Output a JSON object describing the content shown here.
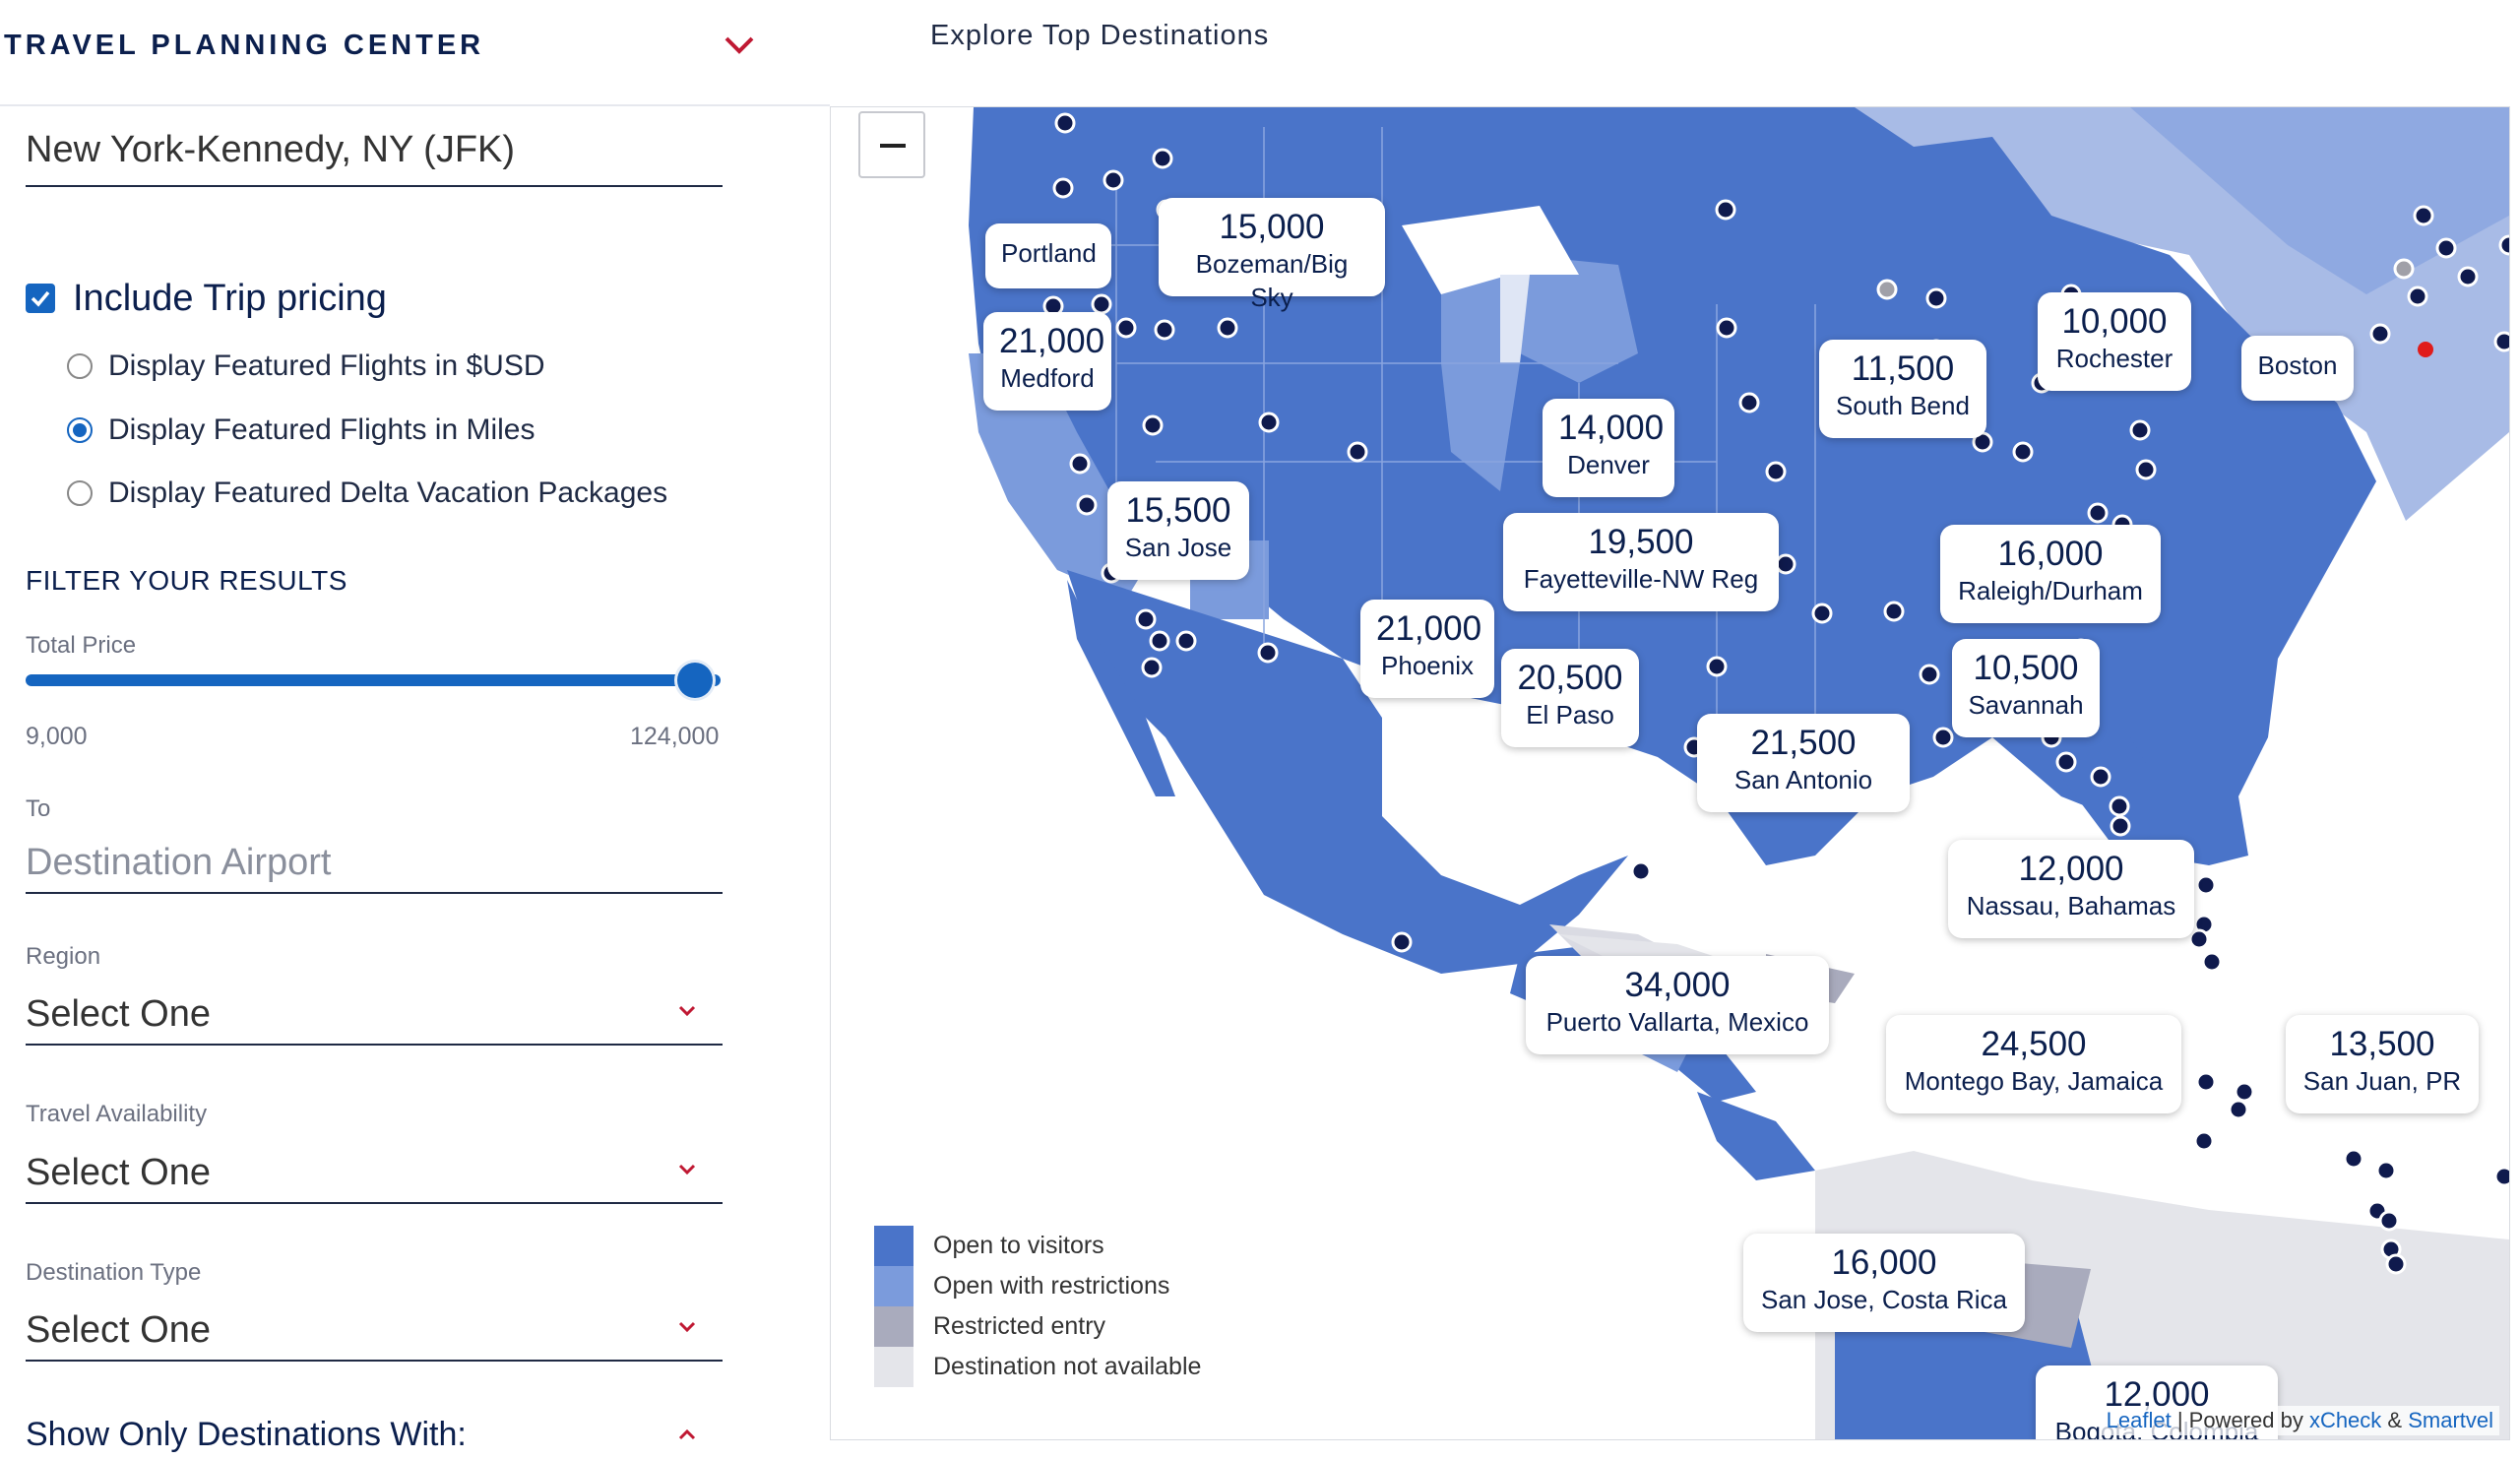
{
  "sidebar": {
    "title": "TRAVEL PLANNING CENTER",
    "origin": "New York-Kennedy, NY (JFK)",
    "include_trip_pricing": "Include Trip pricing",
    "radios": [
      {
        "label": "Display Featured Flights in $USD",
        "selected": false
      },
      {
        "label": "Display Featured Flights in Miles",
        "selected": true
      },
      {
        "label": "Display Featured Delta Vacation Packages",
        "selected": false
      }
    ],
    "filter_heading": "FILTER YOUR RESULTS",
    "total_price_label": "Total Price",
    "price_min": "9,000",
    "price_max": "124,000",
    "price_slider_fraction": 1.0,
    "to_label": "To",
    "to_placeholder": "Destination Airport",
    "region_label": "Region",
    "region_value": "Select One",
    "availability_label": "Travel Availability",
    "availability_value": "Select One",
    "dest_type_label": "Destination Type",
    "dest_type_value": "Select One",
    "show_only": "Show Only Destinations With:"
  },
  "map": {
    "title": "Explore Top Destinations",
    "zoom_out": "−",
    "callouts": [
      {
        "miles": "",
        "city": "Portland"
      },
      {
        "miles": "15,000",
        "city": "Bozeman/Big Sky"
      },
      {
        "miles": "21,000",
        "city": "Medford"
      },
      {
        "miles": "14,000",
        "city": "Denver"
      },
      {
        "miles": "11,500",
        "city": "South Bend"
      },
      {
        "miles": "10,000",
        "city": "Rochester"
      },
      {
        "miles": "",
        "city": "Boston"
      },
      {
        "miles": "15,500",
        "city": "San Jose"
      },
      {
        "miles": "19,500",
        "city": "Fayetteville-NW Reg"
      },
      {
        "miles": "16,000",
        "city": "Raleigh/Durham"
      },
      {
        "miles": "21,000",
        "city": "Phoenix"
      },
      {
        "miles": "20,500",
        "city": "El Paso"
      },
      {
        "miles": "10,500",
        "city": "Savannah"
      },
      {
        "miles": "21,500",
        "city": "San Antonio"
      },
      {
        "miles": "12,000",
        "city": "Nassau, Bahamas"
      },
      {
        "miles": "34,000",
        "city": "Puerto Vallarta, Mexico"
      },
      {
        "miles": "24,500",
        "city": "Montego Bay, Jamaica"
      },
      {
        "miles": "13,500",
        "city": "San Juan, PR"
      },
      {
        "miles": "16,000",
        "city": "San Jose, Costa Rica"
      },
      {
        "miles": "12,000",
        "city": "Bogota, Colombia"
      }
    ],
    "legend": [
      {
        "label": "Open to visitors",
        "color": "#4a74c9"
      },
      {
        "label": "Open with restrictions",
        "color": "#7b9bdc"
      },
      {
        "label": "Restricted entry",
        "color": "#a9abbd"
      },
      {
        "label": "Destination not available",
        "color": "#e4e5ea"
      }
    ],
    "attribution": {
      "leaflet": "Leaflet",
      "sep": " | Powered by ",
      "xcheck": "xCheck",
      "amp": " & ",
      "smartvel": "Smartvel"
    }
  },
  "colors": {
    "accent": "#1565c0",
    "navy": "#0b1f4d",
    "open": "#4a74c9"
  }
}
